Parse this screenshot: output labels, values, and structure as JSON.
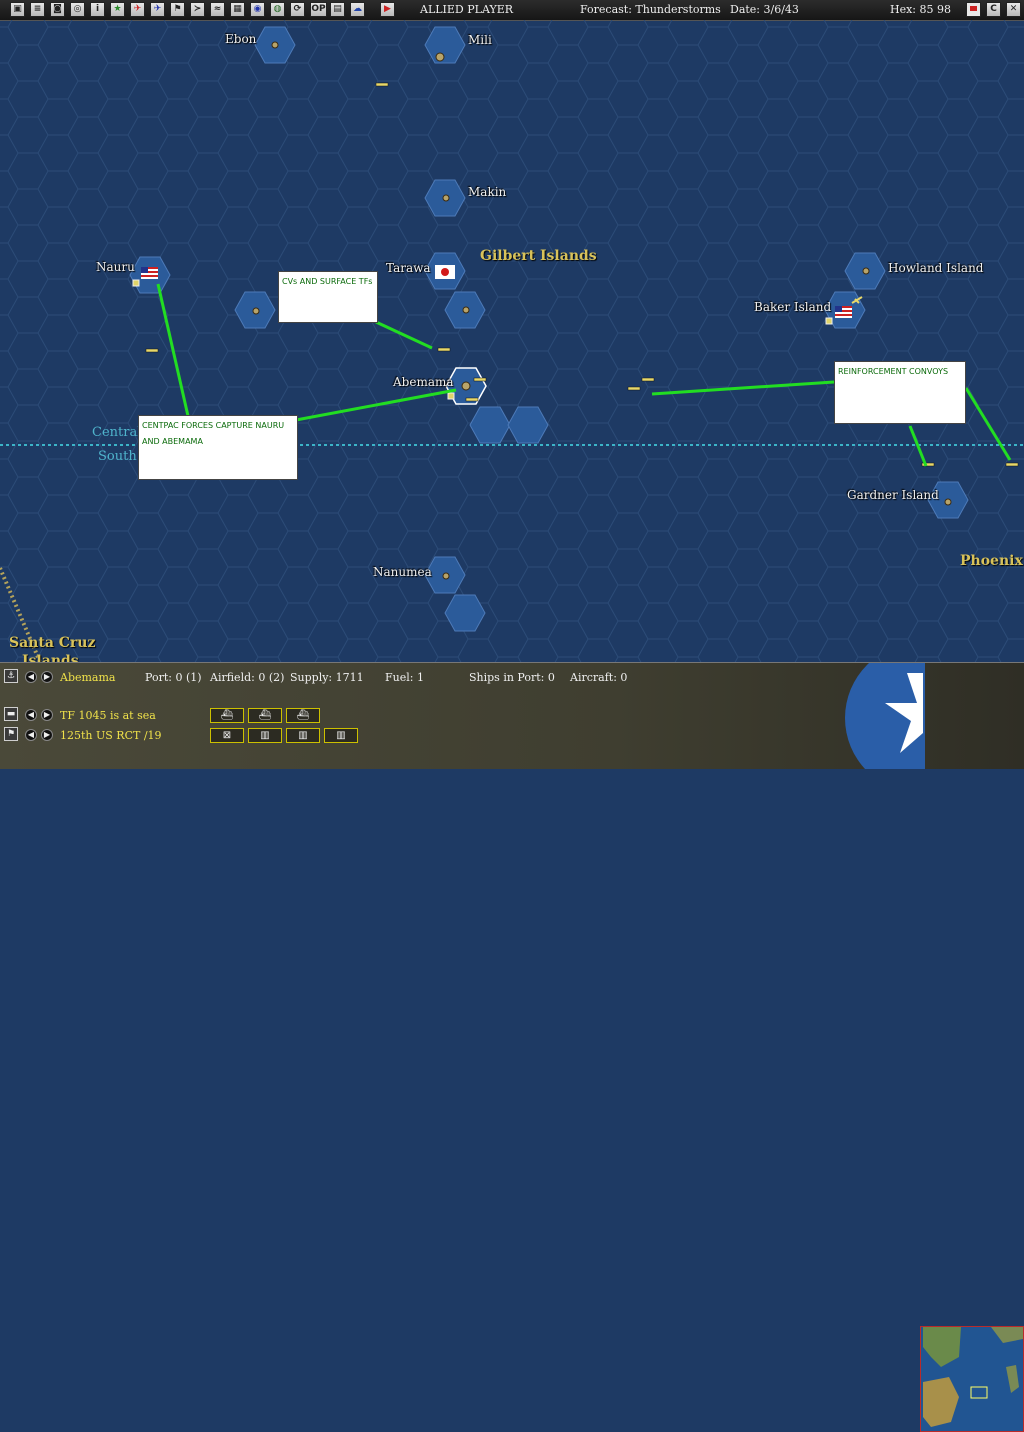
{
  "toolbar": {
    "buttons": [
      "report-icon",
      "list-icon",
      "ship-icon",
      "task-force-icon",
      "info-icon",
      "star-icon",
      "plane-icon",
      "plane-blue-icon",
      "flag-icon",
      "aircraft-icon",
      "route-icon",
      "grid-icon",
      "base-icon",
      "globe-icon",
      "refresh-icon",
      "op-icon",
      "save-icon",
      "weather-icon",
      "play-icon"
    ],
    "op_label": "OP",
    "player": "ALLIED PLAYER",
    "forecast": "Forecast: Thunderstorms",
    "date": "Date: 3/6/43",
    "hex": "Hex: 85 98",
    "right_buttons": [
      {
        "name": "flag-icon",
        "label": ""
      },
      {
        "name": "c-button",
        "label": "C"
      },
      {
        "name": "close-icon",
        "label": "✕"
      }
    ]
  },
  "map": {
    "islands": [
      {
        "name": "Ebon"
      },
      {
        "name": "Mili"
      },
      {
        "name": "Makin"
      },
      {
        "name": "Tarawa"
      },
      {
        "name": "Nauru"
      },
      {
        "name": "Abemama"
      },
      {
        "name": "Howland Island"
      },
      {
        "name": "Baker Island"
      },
      {
        "name": "Gardner Island"
      },
      {
        "name": "Nanumea"
      }
    ],
    "regions": {
      "gilbert": "Gilbert Islands",
      "phoenix": "Phoenix I",
      "santa_cruz_1": "Santa Cruz",
      "santa_cruz_2": "Islands"
    },
    "boundary": {
      "north": "Central",
      "south": "South"
    },
    "notes": {
      "cv_surface": "CVs AND SURFACE TFs",
      "centpac": "CENTPAC FORCES CAPTURE NAURU AND ABEMAMA",
      "reinforcement": "REINFORCEMENT CONVOYS"
    },
    "colors": {
      "sea": "#1e3a64",
      "hex_line": "#2d4c78",
      "note_line": "#22dd22",
      "boundary": "#3cb4c8",
      "land": "#2b5b9a"
    }
  },
  "info_bar": {
    "base_name": "Abemama",
    "port": "Port: 0 (1)",
    "airfield": "Airfield: 0 (2)",
    "supply": "Supply: 1711",
    "fuel": "Fuel: 1",
    "ships_in_port": "Ships in Port: 0",
    "aircraft": "Aircraft: 0",
    "tf_status": "TF 1045 is at sea",
    "unit": "125th US RCT /19",
    "slot_labels": [
      "",
      "",
      "",
      "",
      "",
      "",
      ""
    ]
  }
}
